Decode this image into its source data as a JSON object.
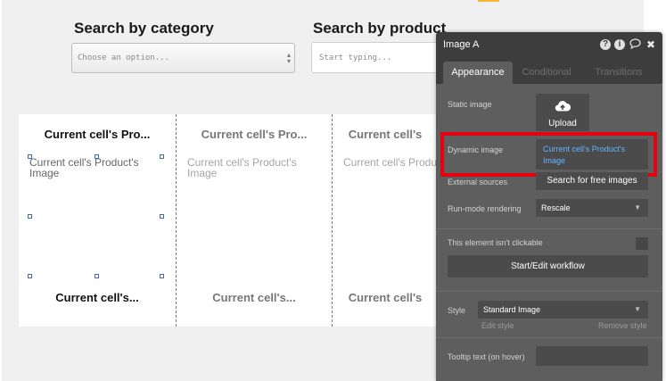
{
  "search": {
    "category_title": "Search by category",
    "category_placeholder": "Choose an option...",
    "product_title": "Search by product",
    "product_placeholder": "Start typing..."
  },
  "repeating_group": {
    "cells": [
      {
        "title": "Current cell's Pro...",
        "image_text": "Current cell's Product's Image",
        "bottom": "Current cell's..."
      },
      {
        "title": "Current cell's Pro...",
        "image_text": "Current cell's Product's Image",
        "bottom": "Current cell's..."
      },
      {
        "title": "Current cell's",
        "image_text": "Current cell's Produ",
        "bottom": "Current cell's"
      }
    ]
  },
  "panel": {
    "title": "Image A",
    "tabs": {
      "appearance": "Appearance",
      "conditional": "Conditional",
      "transitions": "Transitions"
    },
    "static_image_label": "Static image",
    "upload_label": "Upload",
    "dynamic_image_label": "Dynamic image",
    "dynamic_image_value": "Current cell's Product's Image",
    "external_sources_label": "External sources",
    "search_free_images": "Search for free images",
    "run_mode_label": "Run-mode rendering",
    "run_mode_value": "Rescale",
    "not_clickable_label": "This element isn't clickable",
    "workflow_button": "Start/Edit workflow",
    "style_label": "Style",
    "style_value": "Standard Image",
    "edit_style": "Edit style",
    "remove_style": "Remove style",
    "tooltip_label": "Tooltip text (on hover)"
  },
  "colors": {
    "highlight": "#e8000f",
    "link_blue": "#64b4ff",
    "panel_bg": "#5e5e5e",
    "panel_header": "#3d3d3d",
    "top_accent": "#f2b632"
  },
  "icons": [
    "help-icon",
    "info-icon",
    "comment-icon",
    "close-icon",
    "cloud-upload-icon",
    "caret-down-icon"
  ]
}
